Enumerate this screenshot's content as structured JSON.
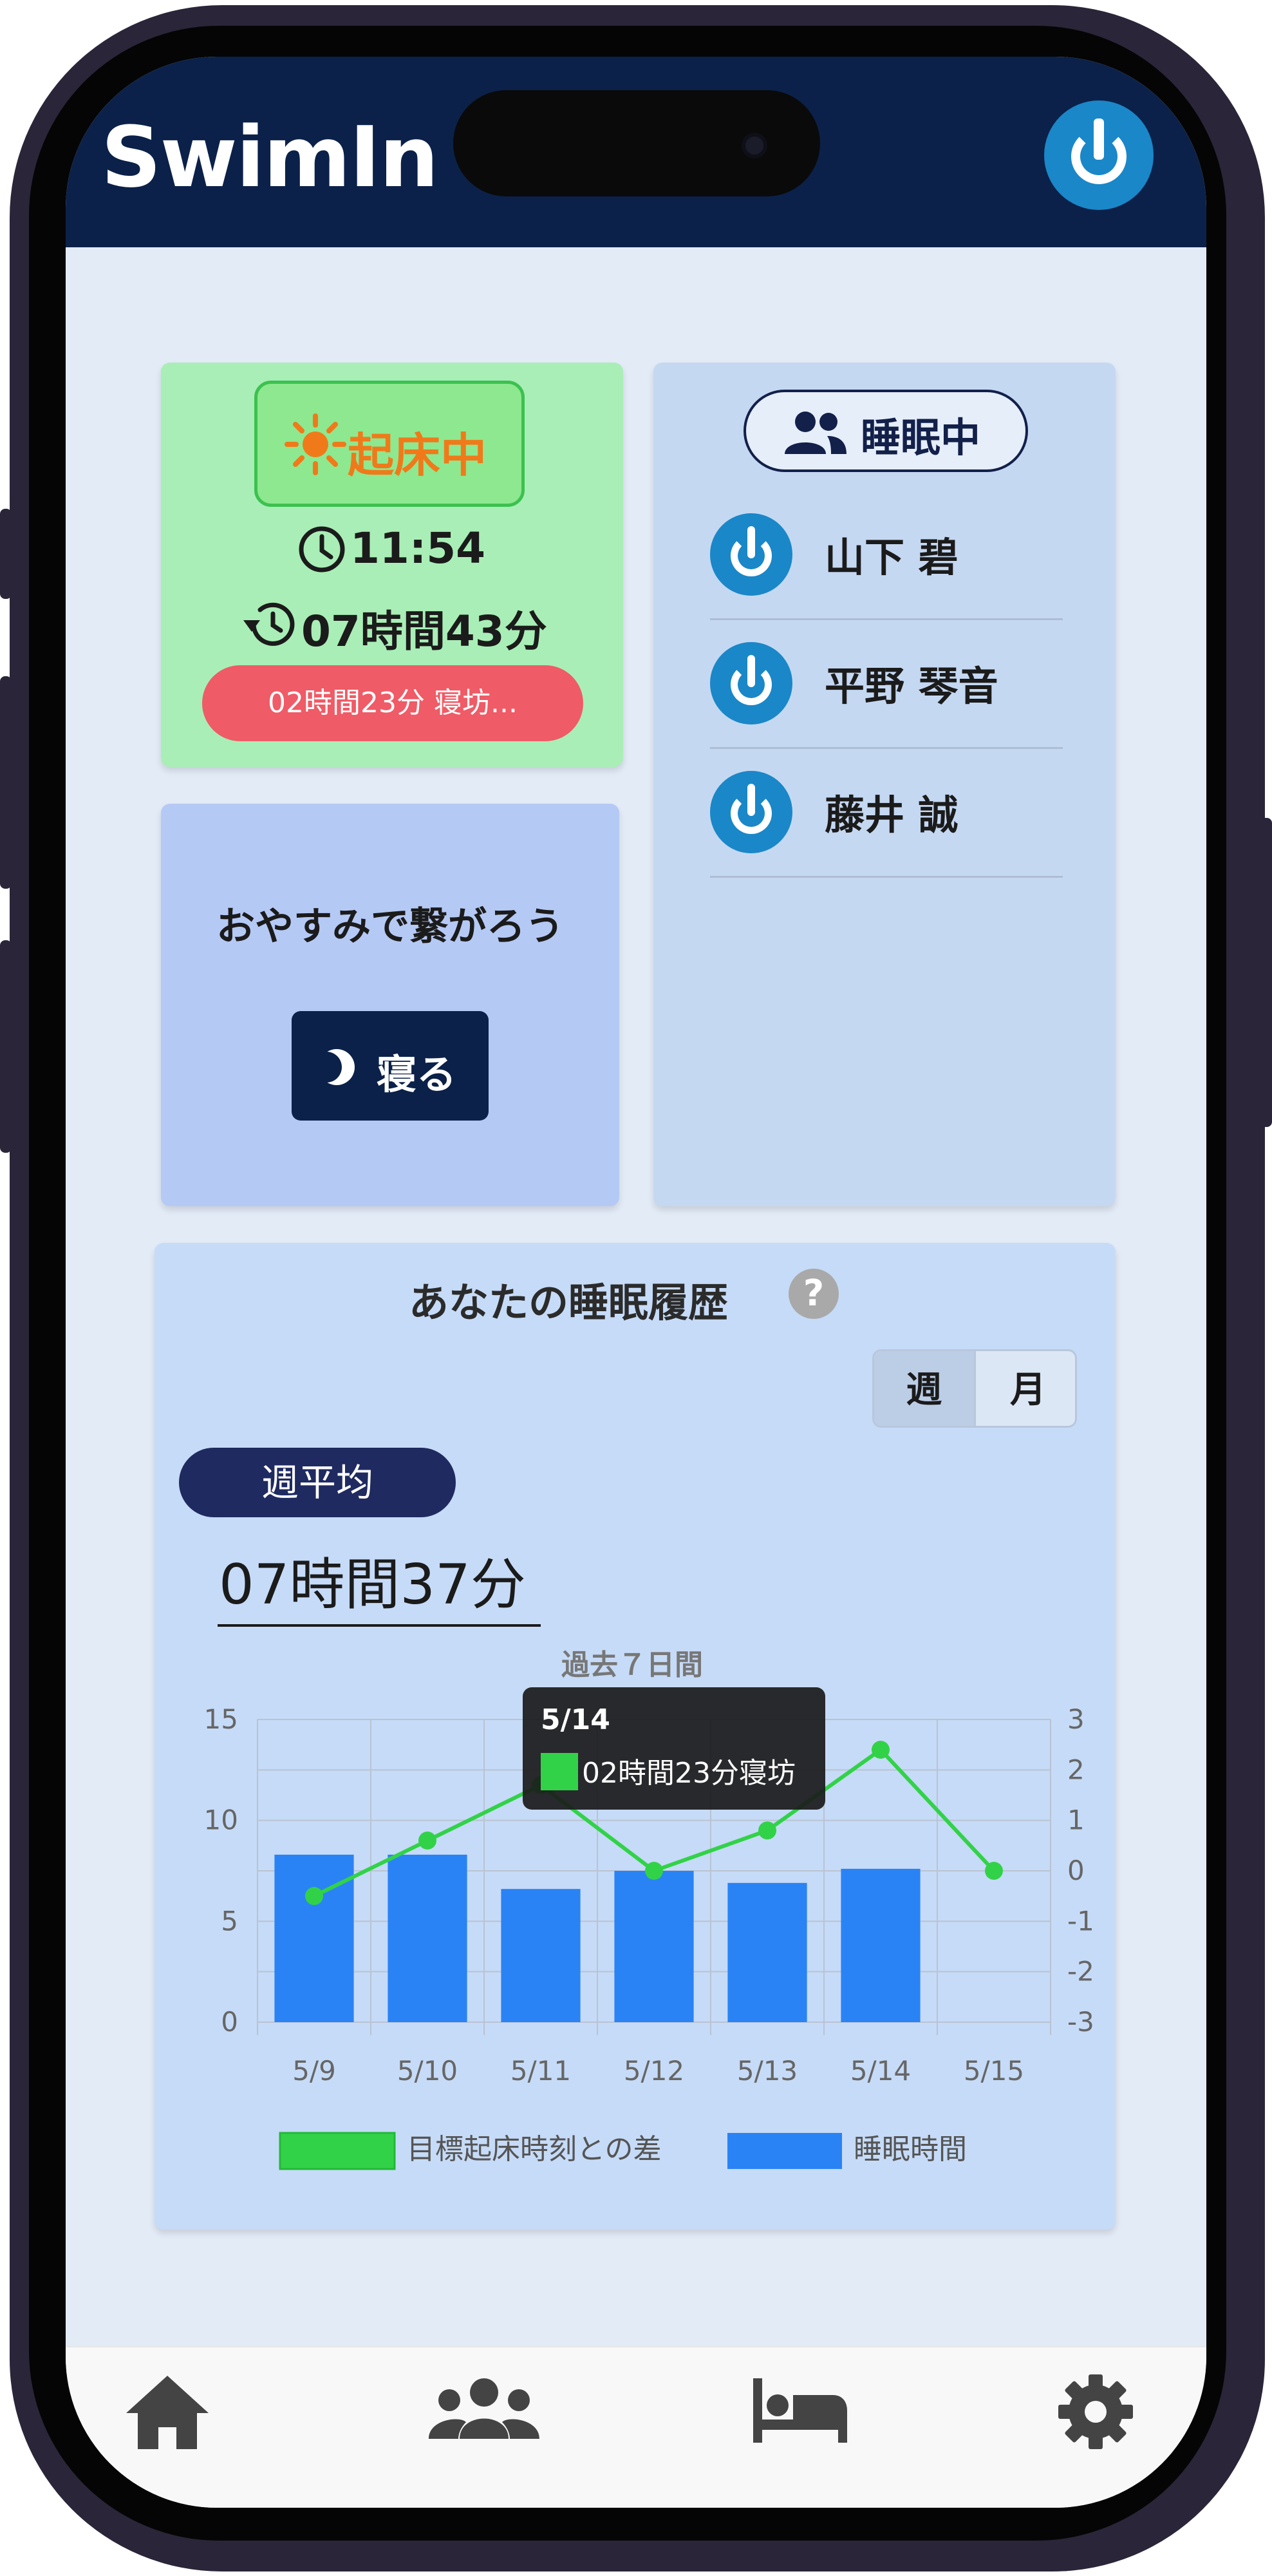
{
  "app": {
    "title": "SwimIn"
  },
  "status": {
    "label": "起床中",
    "wake_time": "11:54",
    "elapsed": "07時間43分",
    "late_text": "02時間23分 寝坊..."
  },
  "sleep": {
    "prompt": "おやすみで繋がろう",
    "button_label": "寝る"
  },
  "friends": {
    "title": "睡眠中",
    "items": [
      {
        "name": "山下 碧"
      },
      {
        "name": "平野 琴音"
      },
      {
        "name": "藤井 誠"
      }
    ]
  },
  "history": {
    "title": "あなたの睡眠履歴",
    "help": "?",
    "toggle": {
      "week": "週",
      "month": "月",
      "selected": "週"
    },
    "avg_label": "週平均",
    "avg_value": "07時間37分"
  },
  "tooltip": {
    "date": "5/14",
    "text": "02時間23分寝坊"
  },
  "colors": {
    "header": "#0b2149",
    "accent_blue": "#1a87c8",
    "bar": "#2a83f5",
    "line": "#32d248"
  },
  "icons": [
    "power-icon",
    "sun-icon",
    "clock-icon",
    "history-icon",
    "users-icon",
    "moon-icon",
    "home-icon",
    "bed-icon",
    "gear-icon",
    "help-icon"
  ],
  "chart_data": {
    "type": "bar",
    "title": "過去７日間",
    "categories": [
      "5/9",
      "5/10",
      "5/11",
      "5/12",
      "5/13",
      "5/14",
      "5/15"
    ],
    "y_left": {
      "ticks": [
        "15",
        "10",
        "5",
        "0"
      ],
      "ylim": [
        0,
        15
      ]
    },
    "y_right": {
      "ticks": [
        "3",
        "2",
        "1",
        "0",
        "-1",
        "-2",
        "-3"
      ],
      "ylim": [
        -3,
        3
      ]
    },
    "series": [
      {
        "name": "睡眠時間",
        "type": "bar",
        "axis": "left",
        "values": [
          8.3,
          8.3,
          6.6,
          7.5,
          6.9,
          7.6,
          null
        ]
      },
      {
        "name": "目標起床時刻との差",
        "type": "line",
        "axis": "right",
        "values": [
          -0.5,
          0.6,
          1.7,
          0.0,
          0.8,
          2.4,
          0.0
        ]
      }
    ],
    "grid": true,
    "legend": "bottom"
  }
}
